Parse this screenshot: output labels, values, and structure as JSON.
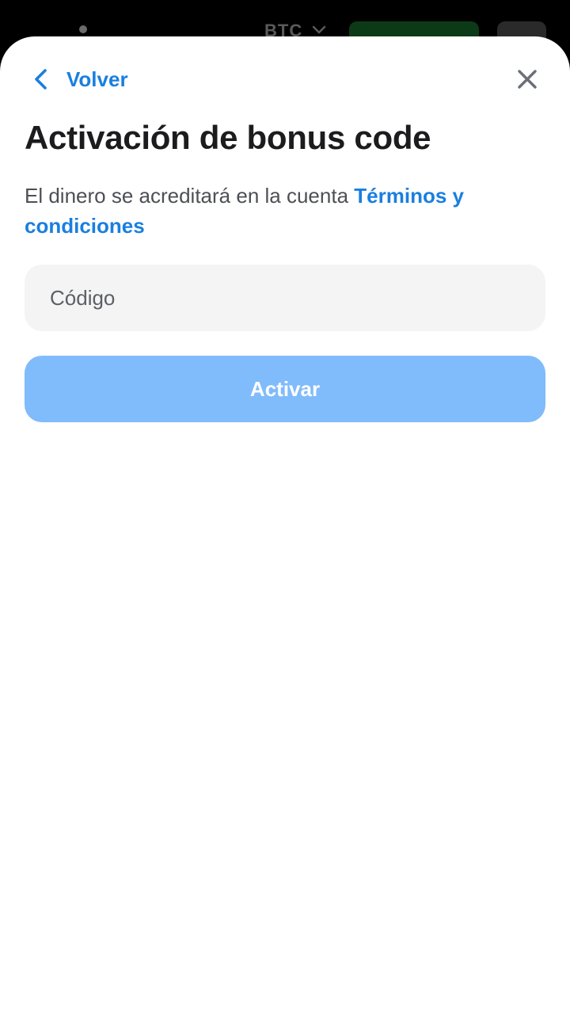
{
  "background": {
    "currency_label": "BTC"
  },
  "header": {
    "back_label": "Volver",
    "back_icon": "chevron-left-icon",
    "close_icon": "close-icon"
  },
  "main": {
    "title": "Activación de bonus code",
    "description": "El dinero se acreditará en la cuenta",
    "terms_link": "Términos y condiciones",
    "code_input": {
      "value": "",
      "placeholder": "Código"
    },
    "activate_button": "Activar"
  },
  "colors": {
    "accent": "#1a7fe0",
    "button_disabled": "#80bbfc",
    "input_background": "#f4f4f5",
    "title_text": "#1c1c1e",
    "body_text": "#4d4f55"
  }
}
